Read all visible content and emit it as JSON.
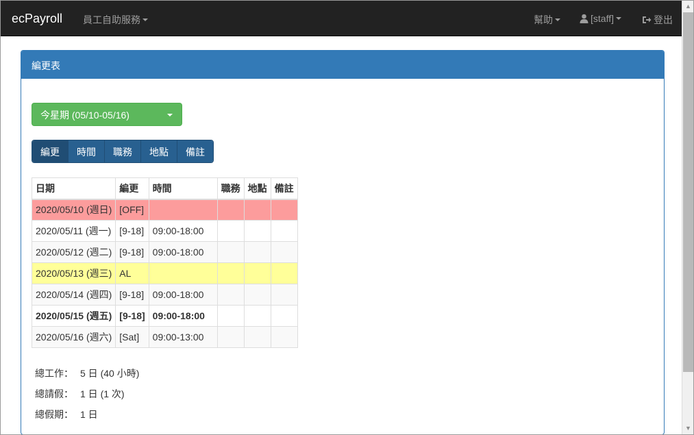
{
  "navbar": {
    "brand": "ecPayroll",
    "self_service": "員工自助服務",
    "help": "幫助",
    "user": "[staff]",
    "logout": "登出"
  },
  "panel": {
    "title": "編更表",
    "week_select": "今星期 (05/10-05/16)",
    "toggle_buttons": [
      "編更",
      "時間",
      "職務",
      "地點",
      "備註"
    ],
    "table": {
      "headers": [
        "日期",
        "編更",
        "時間",
        "職務",
        "地點",
        "備註"
      ],
      "rows": [
        {
          "date": "2020/05/10 (週日)",
          "shift": "[OFF]",
          "time": "",
          "duty": "",
          "location": "",
          "remark": ""
        },
        {
          "date": "2020/05/11 (週一)",
          "shift": "[9-18]",
          "time": "09:00-18:00",
          "duty": "",
          "location": "",
          "remark": ""
        },
        {
          "date": "2020/05/12 (週二)",
          "shift": "[9-18]",
          "time": "09:00-18:00",
          "duty": "",
          "location": "",
          "remark": ""
        },
        {
          "date": "2020/05/13 (週三)",
          "shift": "AL",
          "time": "",
          "duty": "",
          "location": "",
          "remark": ""
        },
        {
          "date": "2020/05/14 (週四)",
          "shift": "[9-18]",
          "time": "09:00-18:00",
          "duty": "",
          "location": "",
          "remark": ""
        },
        {
          "date": "2020/05/15 (週五)",
          "shift": "[9-18]",
          "time": "09:00-18:00",
          "duty": "",
          "location": "",
          "remark": ""
        },
        {
          "date": "2020/05/16 (週六)",
          "shift": "[Sat]",
          "time": "09:00-13:00",
          "duty": "",
          "location": "",
          "remark": ""
        }
      ]
    },
    "summary": {
      "work_label": "總工作：",
      "work_value": "5 日 (40 小時)",
      "leave_label": "總請假：",
      "leave_value": "1 日 (1 次)",
      "holiday_label": "總假期：",
      "holiday_value": "1 日"
    }
  },
  "icons": {
    "user": "user-icon",
    "logout": "logout-icon"
  },
  "colors": {
    "navbar_bg": "#222222",
    "panel_primary": "#337ab7",
    "success": "#5cb85c",
    "off_row": "#fc9c9c",
    "leave_row": "#ffff99"
  }
}
